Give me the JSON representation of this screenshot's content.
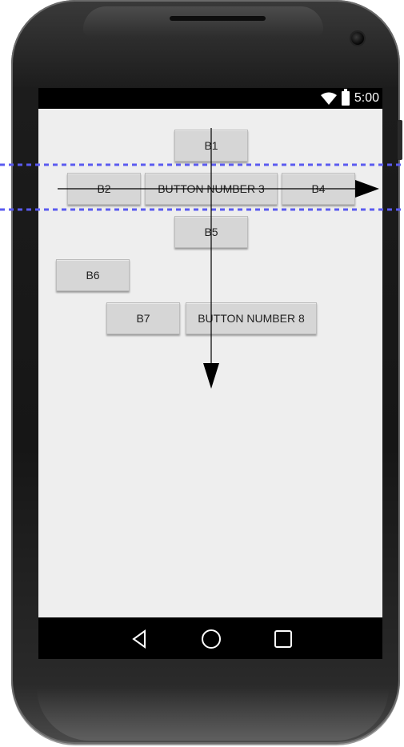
{
  "status_bar": {
    "time": "5:00",
    "icons": [
      "wifi-icon",
      "battery-icon"
    ]
  },
  "buttons": {
    "b1": "B1",
    "b2": "B2",
    "b3": "BUTTON NUMBER 3",
    "b4": "B4",
    "b5": "B5",
    "b6": "B6",
    "b7": "B7",
    "b8": "BUTTON NUMBER 8"
  },
  "nav_bar": {
    "icons": [
      "back-icon",
      "home-icon",
      "recents-icon"
    ]
  },
  "colors": {
    "screen_background": "#eeeeee",
    "button_background": "#d6d6d6",
    "guide_line": "#5b5bf0",
    "axis_arrow": "#000000"
  }
}
